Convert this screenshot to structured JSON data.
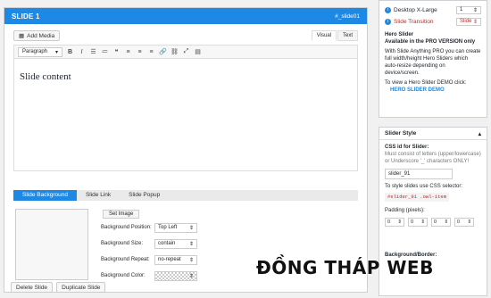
{
  "slide": {
    "title": "SLIDE 1",
    "id_tag": "#_slide01",
    "add_media": "Add Media",
    "editor_tabs": [
      "Visual",
      "Text"
    ],
    "format_select": "Paragraph",
    "content": "Slide content"
  },
  "tabs": [
    "Slide Background",
    "Slide Link",
    "Slide Popup"
  ],
  "background": {
    "set_image": "Set Image",
    "position_label": "Background Position:",
    "position_value": "Top Left",
    "size_label": "Background Size:",
    "size_value": "contain",
    "repeat_label": "Background Repeat:",
    "repeat_value": "no-repeat",
    "color_label": "Background Color:"
  },
  "buttons": {
    "delete": "Delete Slide",
    "duplicate": "Duplicate Slide"
  },
  "sidebar": {
    "desktop_label": "Desktop X-Large",
    "desktop_value": "1",
    "transition_label": "Slide Transition",
    "transition_value": "Slide",
    "hero_title": "Hero Slider",
    "hero_sub": "Available in the PRO VERSION only",
    "hero_text1": "With Slide Anything PRO you can create full width/height Hero Sliders which auto-resize depending on device/screen.",
    "hero_text2": "To view a Hero Slider DEMO click:",
    "hero_link": "HERO SLIDER DEMO",
    "style_title": "Slider Style",
    "css_label": "CSS id for Slider:",
    "css_note": "Must consist of letters (upper/lowercase) or Underscore '_' characters ONLY!",
    "css_value": "slider_91",
    "selector_note": "To style slides use CSS selector:",
    "selector_value": "#slider_91 .owl-item",
    "padding_label": "Padding (pixels):",
    "padding_values": [
      "0",
      "0",
      "0",
      "0"
    ],
    "bgborder_label": "Background/Border:"
  },
  "watermark": "ĐỒNG THÁP WEB"
}
